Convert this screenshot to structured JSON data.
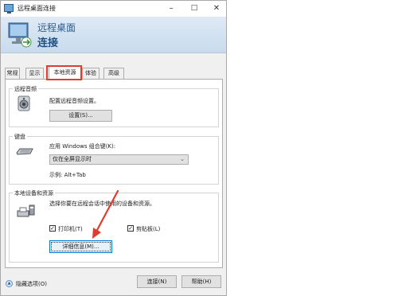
{
  "window": {
    "title": "远程桌面连接",
    "controls": {
      "minimize": "–",
      "maximize": "□",
      "close": "✕"
    }
  },
  "banner": {
    "line1": "远程桌面",
    "line2": "连接"
  },
  "tabs": [
    {
      "label": "常规"
    },
    {
      "label": "显示"
    },
    {
      "label": "本地资源",
      "selected": true
    },
    {
      "label": "体验"
    },
    {
      "label": "高级"
    }
  ],
  "remote_audio": {
    "title": "远程音频",
    "description": "配置远程音频设置。",
    "settings_button": "设置(S)..."
  },
  "keyboard": {
    "title": "键盘",
    "apply_label": "应用 Windows 组合键(K):",
    "select_value": "仅在全屏显示时",
    "example": "示例: Alt+Tab"
  },
  "local_devices": {
    "title": "本地设备和资源",
    "description": "选择你要在远程会话中使用的设备和资源。",
    "printer_label": "打印机(T)",
    "printer_checked": true,
    "clipboard_label": "剪贴板(L)",
    "clipboard_checked": true,
    "details_button": "详细信息(M)..."
  },
  "footer": {
    "hide_options": "隐藏选项(O)",
    "connect_button": "连接(N)",
    "help_button": "帮助(H)"
  },
  "colors": {
    "highlight": "#e23a2f",
    "banner_text": "#2c5c8c",
    "focus_border": "#0078d7"
  },
  "icons": [
    "remote-desktop-app-icon",
    "remote-desktop-banner-icon",
    "speaker-icon",
    "keyboard-icon",
    "devices-icon",
    "chevron-down-icon",
    "collapse-options-icon",
    "red-arrow-annotation"
  ]
}
